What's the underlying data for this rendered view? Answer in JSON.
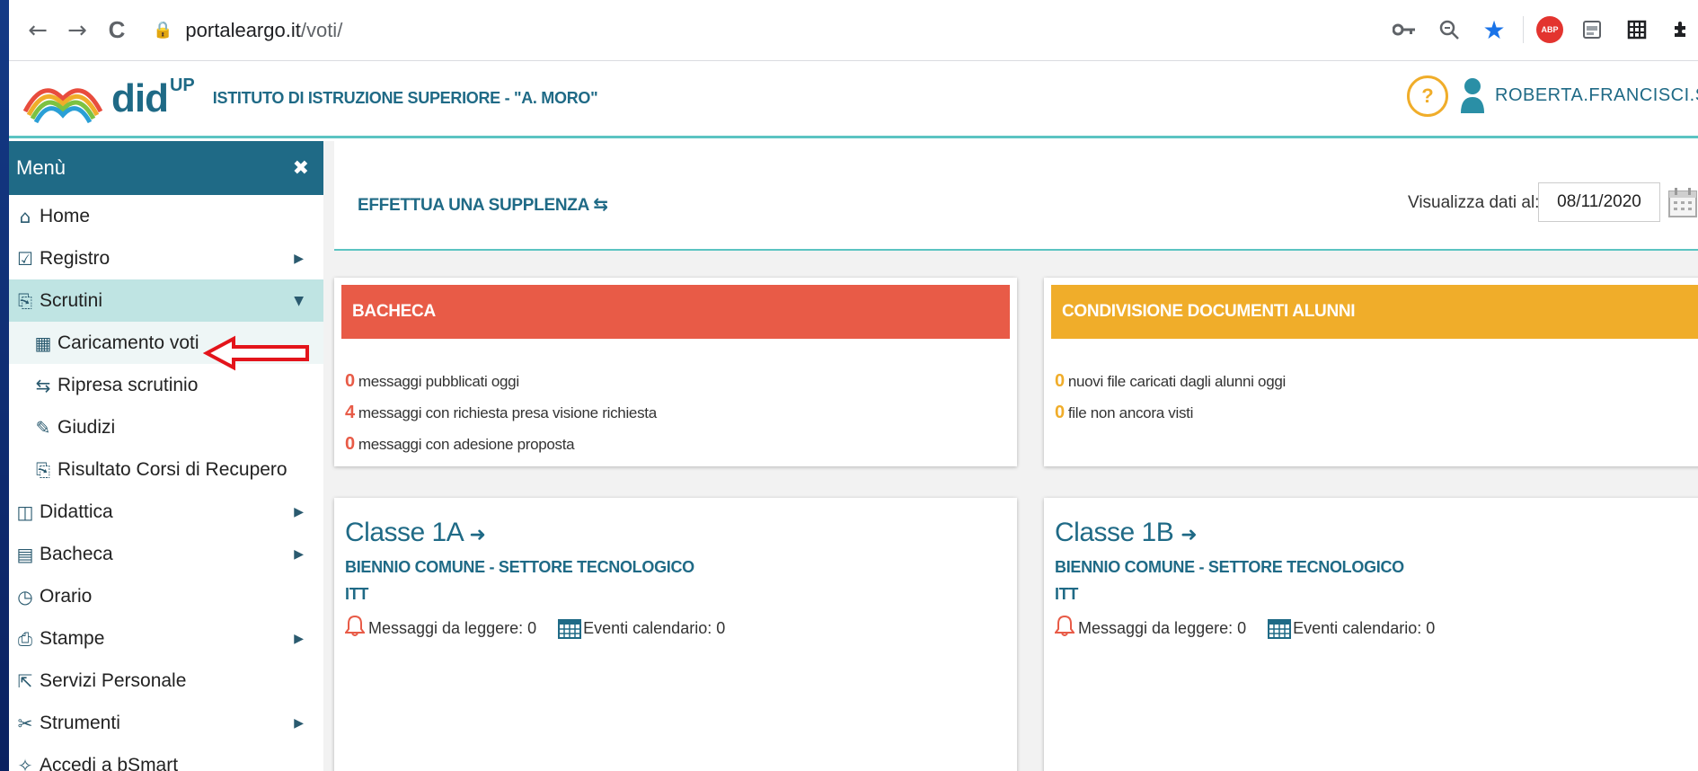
{
  "browser": {
    "back": "←",
    "forward": "→",
    "reload": "C",
    "url_host": "portaleargo.it",
    "url_path": "/voti/",
    "ext_abp": "ABP"
  },
  "header": {
    "logo_text": "did",
    "logo_sup": "UP",
    "school": "ISTITUTO DI ISTRUZIONE SUPERIORE - \"A. MORO\"",
    "help": "?",
    "user": "ROBERTA.FRANCISCI.SC"
  },
  "sidebar": {
    "title": "Menù",
    "close": "✖",
    "items": [
      {
        "label": "Home",
        "icon": "⌂"
      },
      {
        "label": "Registro",
        "icon": "☑"
      },
      {
        "label": "Scrutini",
        "icon": "⎘"
      },
      {
        "label": "Caricamento voti",
        "icon": "▦"
      },
      {
        "label": "Ripresa scrutinio",
        "icon": "⇆"
      },
      {
        "label": "Giudizi",
        "icon": "✎"
      },
      {
        "label": "Risultato Corsi di Recupero",
        "icon": "⎘"
      },
      {
        "label": "Didattica",
        "icon": "◫"
      },
      {
        "label": "Bacheca",
        "icon": "▤"
      },
      {
        "label": "Orario",
        "icon": "◷"
      },
      {
        "label": "Stampe",
        "icon": "⎙"
      },
      {
        "label": "Servizi Personale",
        "icon": "⇱"
      },
      {
        "label": "Strumenti",
        "icon": "✂"
      },
      {
        "label": "Accedi a bSmart",
        "icon": "✧"
      }
    ]
  },
  "toolbar": {
    "supplenza": "EFFETTUA UNA SUPPLENZA",
    "supplenza_icon": "⇆",
    "date_label": "Visualizza dati al:",
    "date_value": "08/11/2020"
  },
  "bacheca": {
    "title": "BACHECA",
    "color": "#e85b47",
    "lines": [
      {
        "num": "0",
        "text": "messaggi pubblicati oggi"
      },
      {
        "num": "4",
        "text": "messaggi con richiesta presa visione richiesta"
      },
      {
        "num": "0",
        "text": "messaggi con adesione proposta"
      }
    ]
  },
  "condivisione": {
    "title": "CONDIVISIONE DOCUMENTI ALUNNI",
    "color": "#f0ad2a",
    "lines": [
      {
        "num": "0",
        "text": "nuovi file caricati dagli alunni oggi"
      },
      {
        "num": "0",
        "text": "file non ancora visti"
      }
    ]
  },
  "classes": [
    {
      "name": "Classe 1A",
      "enter": "➜",
      "track": "BIENNIO COMUNE - SETTORE TECNOLOGICO",
      "school": "ITT",
      "messages": "Messaggi da leggere: 0",
      "events": "Eventi calendario: 0"
    },
    {
      "name": "Classe 1B",
      "enter": "➜",
      "track": "BIENNIO COMUNE - SETTORE TECNOLOGICO",
      "school": "ITT",
      "messages": "Messaggi da leggere: 0",
      "events": "Eventi calendario: 0"
    }
  ],
  "bell_icon": "🔔"
}
